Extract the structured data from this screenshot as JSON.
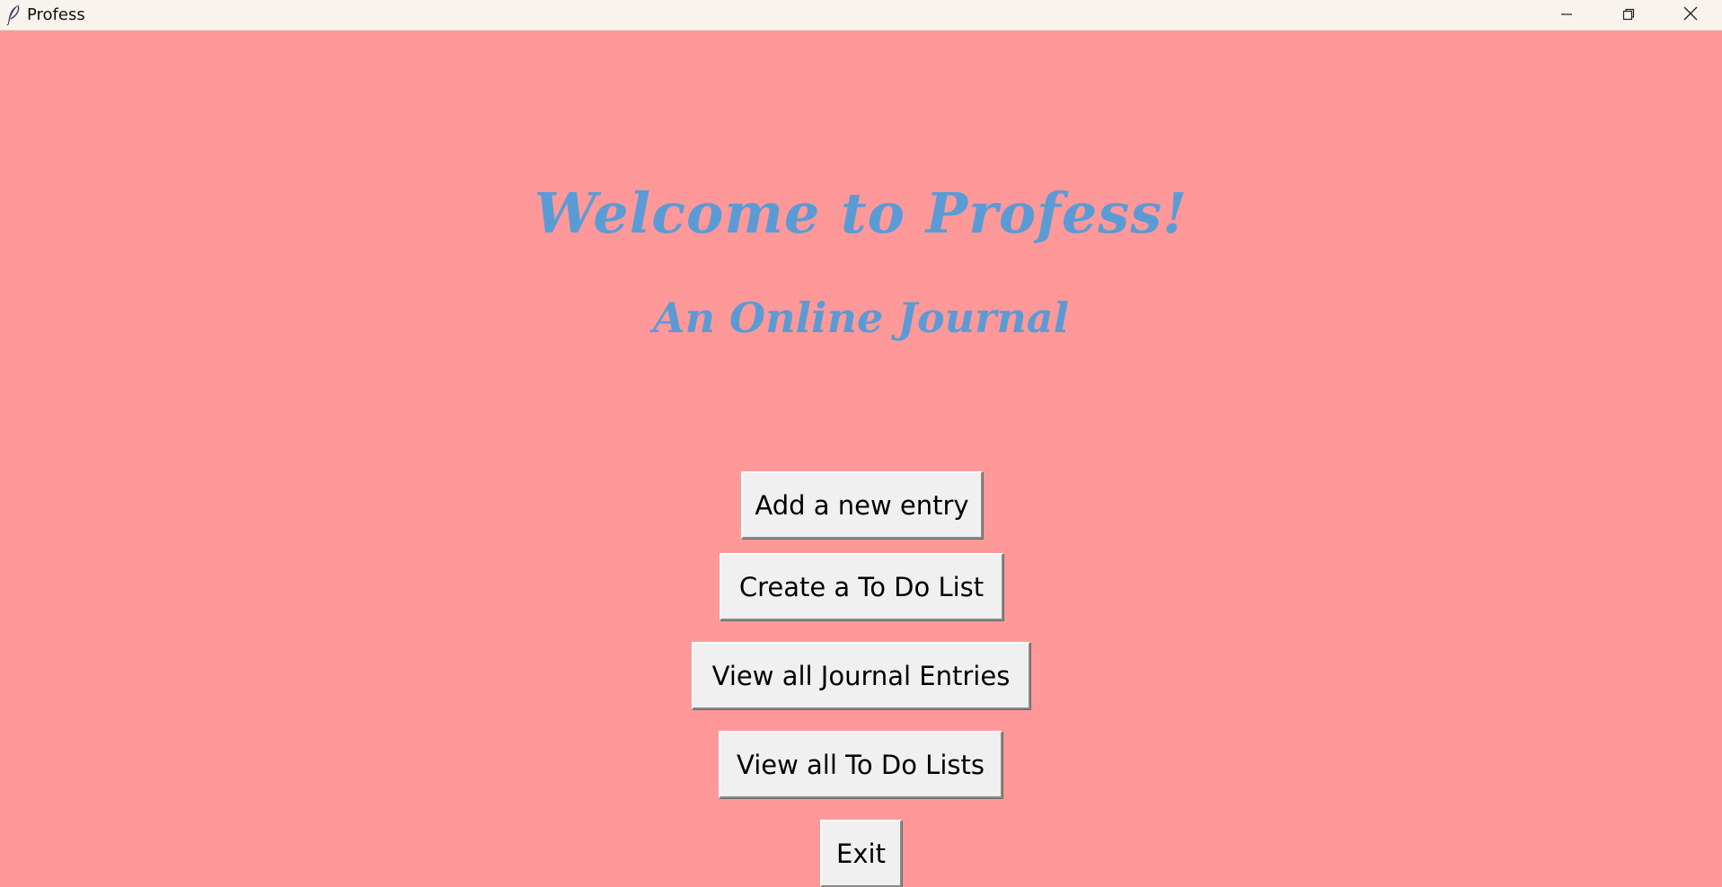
{
  "window": {
    "title": "Profess",
    "background_color": "#FF9999",
    "controls": {
      "minimize_icon": "minimize-icon",
      "maximize_icon": "restore-icon",
      "close_icon": "close-icon"
    },
    "app_icon": "feather-icon"
  },
  "main": {
    "title": "Welcome to Profess!",
    "subtitle": "An Online Journal",
    "heading_color": "#5B9BD5",
    "buttons": [
      {
        "label": "Add a new entry"
      },
      {
        "label": "Create a To Do List"
      },
      {
        "label": "View all Journal Entries"
      },
      {
        "label": "View all To Do Lists"
      },
      {
        "label": "Exit"
      }
    ]
  }
}
